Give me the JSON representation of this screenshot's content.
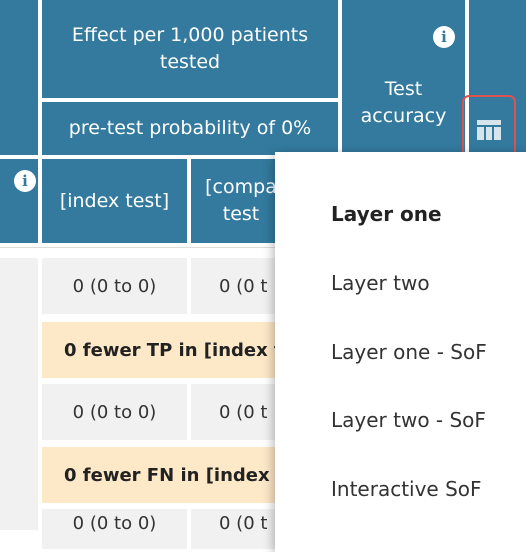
{
  "header": {
    "effect_title": "Effect per 1,000 patients tested",
    "pretest": "pre-test probability of 0%",
    "test_accuracy": "Test accuracy",
    "index_test": "[index test]",
    "comparator_test": "[compa test"
  },
  "rows": [
    {
      "type": "values",
      "index": "0 (0 to 0)",
      "comparator": "0 (0 t"
    },
    {
      "type": "summary",
      "text": "0 fewer TP in [index t"
    },
    {
      "type": "values",
      "index": "0 (0 to 0)",
      "comparator": "0 (0 t"
    },
    {
      "type": "summary",
      "text": "0 fewer FN in [index t"
    },
    {
      "type": "values",
      "index": "0 (0 to 0)",
      "comparator": "0 (0 t"
    }
  ],
  "menu": {
    "items": [
      "Layer one",
      "Layer two",
      "Layer one - SoF",
      "Layer two - SoF",
      "Interactive SoF"
    ],
    "selected": "Layer one"
  },
  "icons": {
    "info": "info-icon",
    "layout": "table-layout-icon"
  },
  "colors": {
    "header_bg": "#337a9e",
    "summary_bg": "#fde8c8",
    "highlight_border": "#d9534f"
  }
}
